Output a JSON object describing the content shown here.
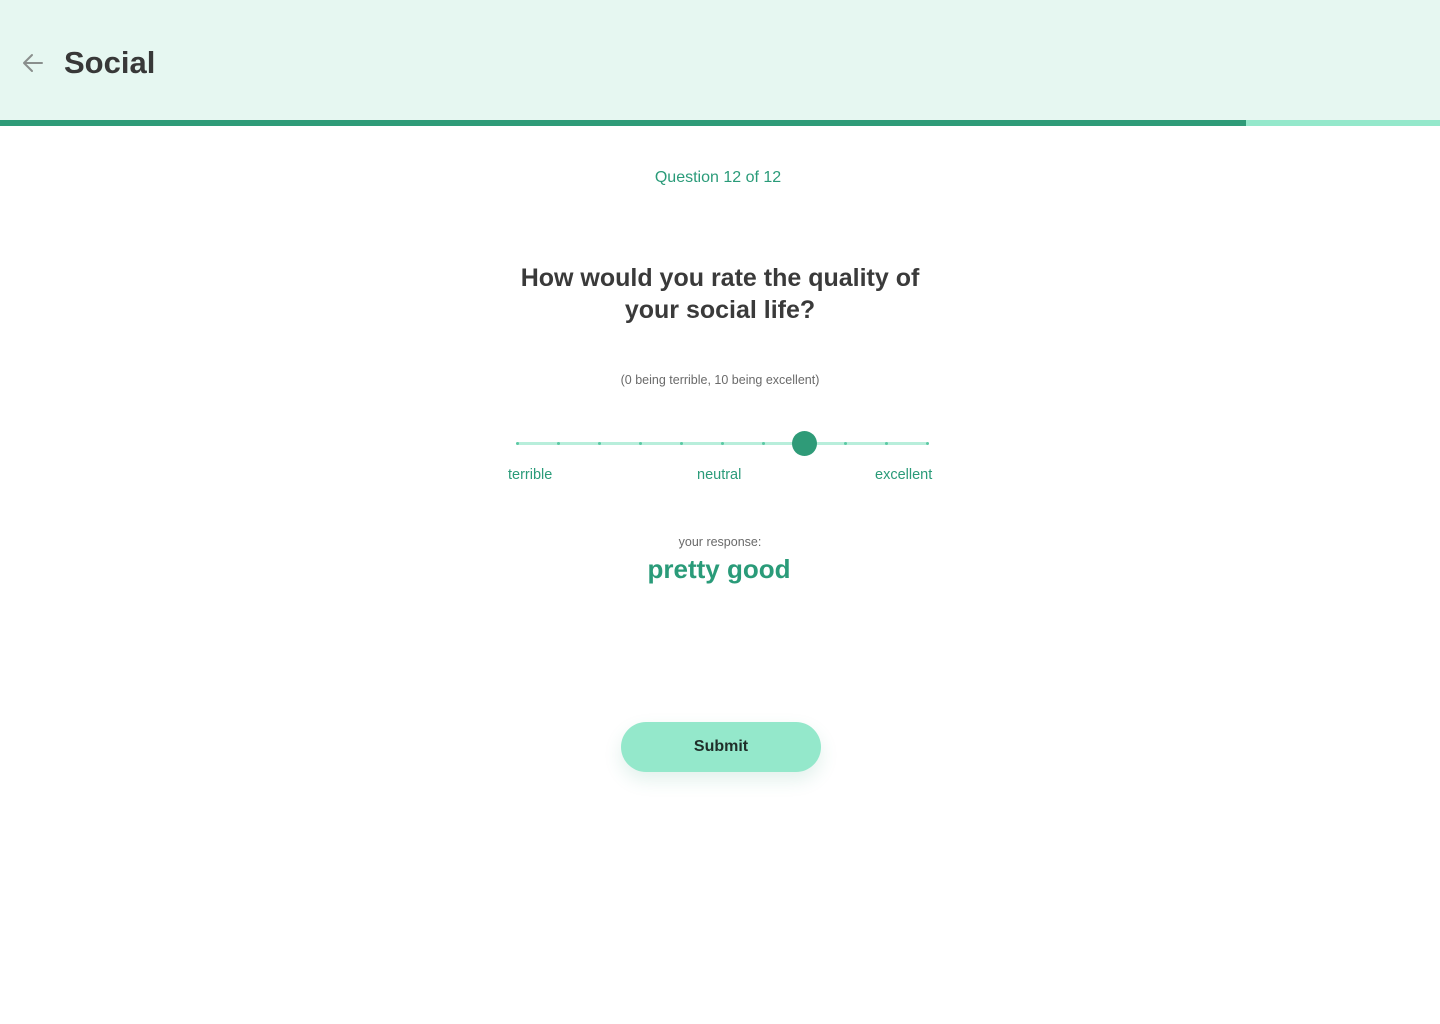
{
  "header": {
    "back_icon": "arrow-left-icon",
    "title": "Social"
  },
  "progress": {
    "current": 12,
    "total": 12,
    "fraction_filled": 0.865,
    "fill_color": "#2f9b78",
    "track_color": "#94e8cb"
  },
  "question": {
    "counter": "Question 12 of 12",
    "text": "How would you rate the quality of your social life?",
    "hint": "(0 being terrible, 10 being excellent)"
  },
  "scale": {
    "min": 0,
    "max": 10,
    "value": 7,
    "labels": {
      "min": "terrible",
      "mid": "neutral",
      "max": "excellent"
    }
  },
  "response": {
    "caption": "your response:",
    "value": "pretty good"
  },
  "submit": {
    "label": "Submit"
  },
  "colors": {
    "accent": "#2a9b79",
    "header_bg": "#e6f7f1",
    "button_bg": "#94e8cb"
  }
}
